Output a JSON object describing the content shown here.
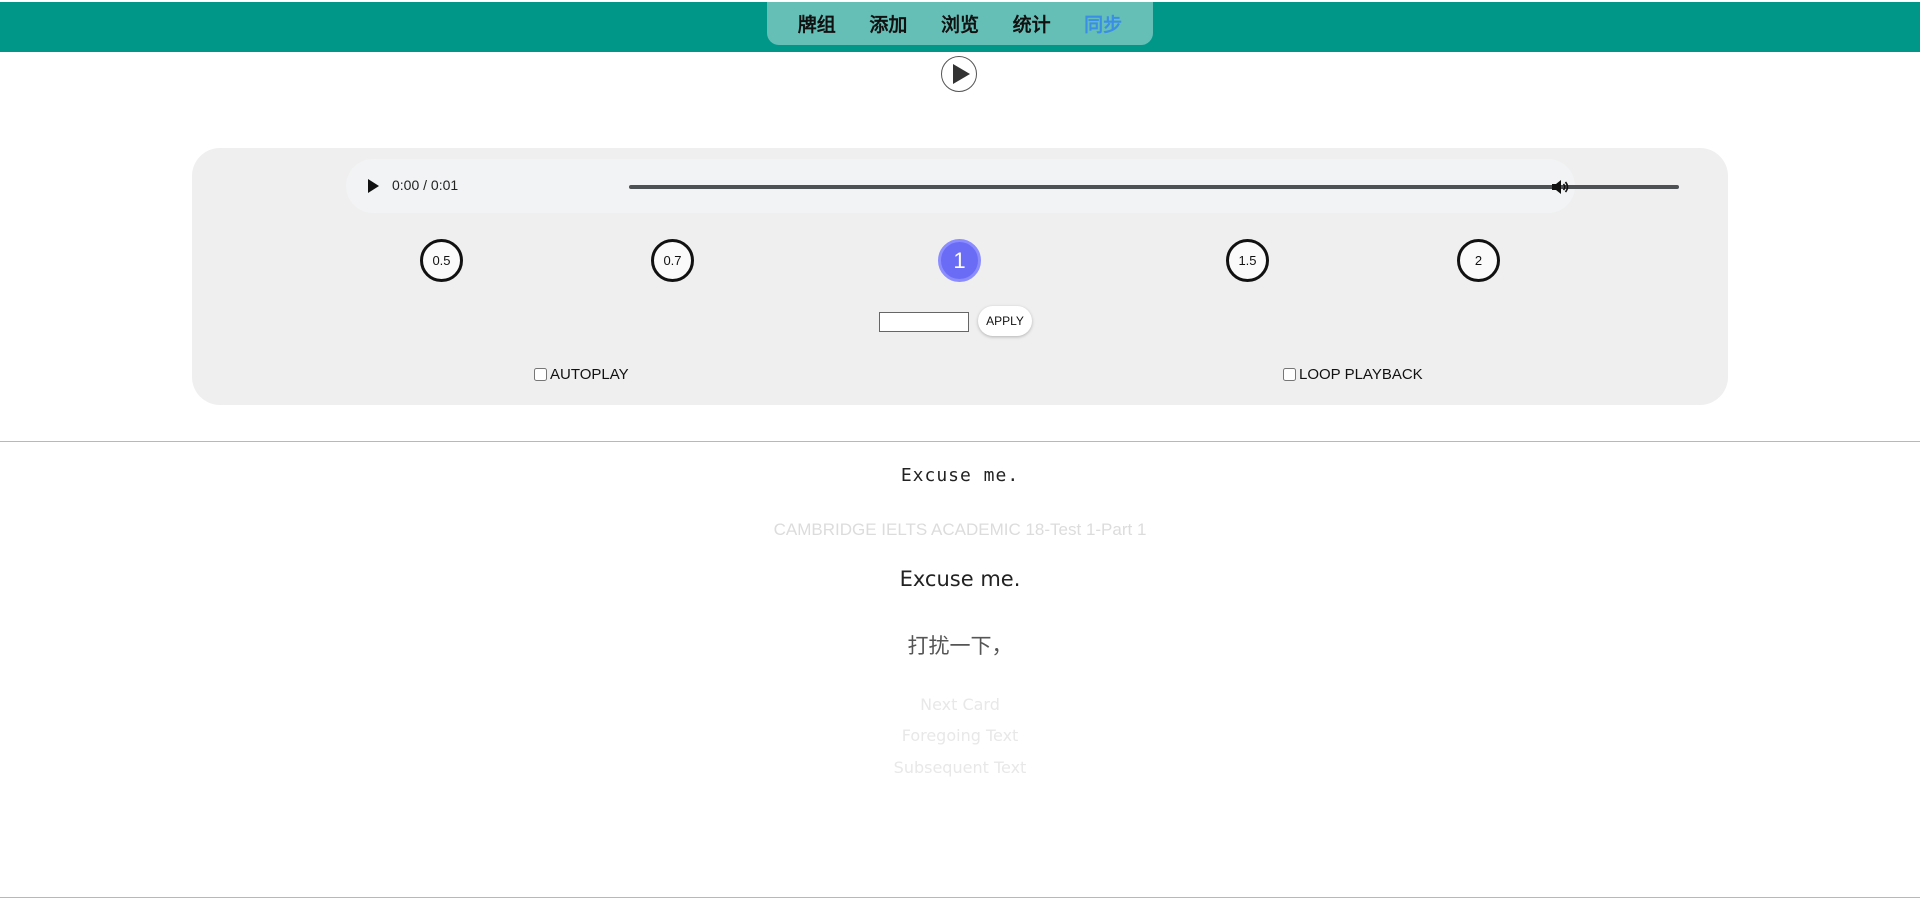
{
  "nav": {
    "items": [
      {
        "label": "牌组"
      },
      {
        "label": "添加"
      },
      {
        "label": "浏览"
      },
      {
        "label": "统计"
      },
      {
        "label": "同步"
      }
    ],
    "active_index": 4
  },
  "player": {
    "time": "0:00 / 0:01",
    "speeds": [
      "0.5",
      "0.7",
      "1",
      "1.5",
      "2"
    ],
    "active_speed": "1",
    "rate_input_value": "",
    "apply_label": "APPLY",
    "autoplay_label": "AUTOPLAY",
    "loop_label": "LOOP PLAYBACK"
  },
  "card": {
    "original": "Excuse me.",
    "source": "CAMBRIDGE IELTS ACADEMIC 18-Test 1-Part 1",
    "sentence": "Excuse me.",
    "translation": "打扰一下，",
    "next_card": "Next Card",
    "foregoing_text": "Foregoing Text",
    "subsequent_text": "Subsequent Text"
  },
  "colors": {
    "topbar": "#009688",
    "nav_active": "#3a8ee6",
    "speed_active": "#6a6cf6"
  },
  "icons": {
    "big_play": "play-circle-icon",
    "audio_play": "play-icon",
    "volume": "volume-icon"
  }
}
